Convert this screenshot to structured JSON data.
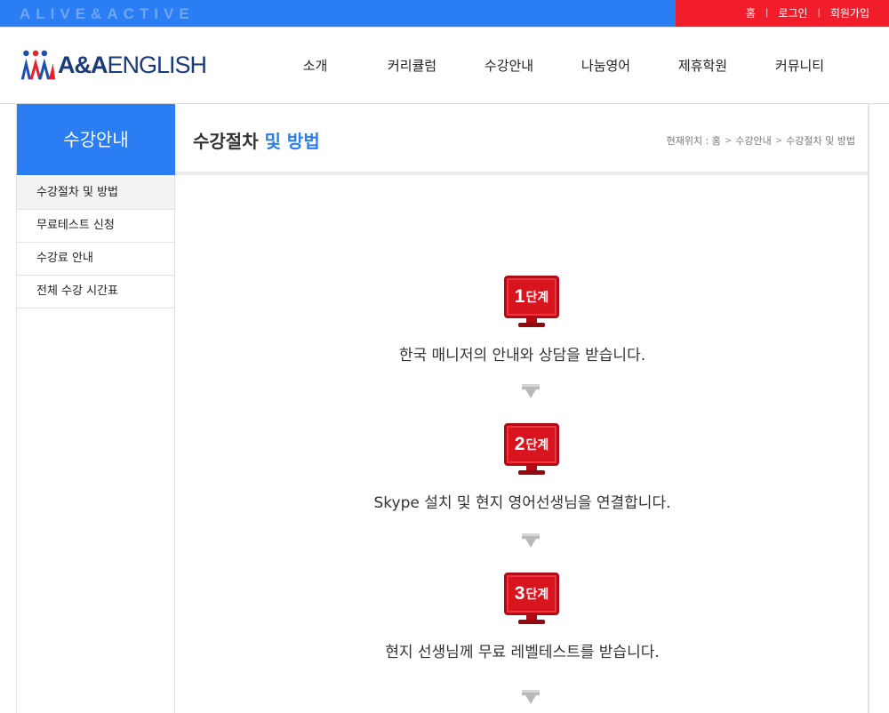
{
  "topbar": {
    "slogan": "ALIVE&ACTIVE",
    "links": [
      "홈",
      "로그인",
      "회원가입"
    ]
  },
  "header": {
    "logo_brand": "A&A",
    "logo_word": "ENGLISH",
    "nav": [
      "소개",
      "커리큘럼",
      "수강안내",
      "나눔영어",
      "제휴학원",
      "커뮤니티"
    ]
  },
  "sidebar": {
    "title": "수강안내",
    "items": [
      {
        "label": "수강절차 및 방법",
        "active": true
      },
      {
        "label": "무료테스트 신청",
        "active": false
      },
      {
        "label": "수강료 안내",
        "active": false
      },
      {
        "label": "전체 수강 시간표",
        "active": false
      }
    ]
  },
  "content": {
    "title_main": "수강절차",
    "title_highlight": " 및 방법",
    "location": {
      "prefix": "현재위치 : 홈",
      "crumb1": "수강안내",
      "crumb2": "수강절차 및 방법"
    },
    "steps": [
      {
        "num": "1",
        "label": "단계",
        "text": "한국 매니저의 안내와 상담을 받습니다."
      },
      {
        "num": "2",
        "label": "단계",
        "text": "Skype 설치 및 현지 영어선생님을 연결합니다."
      },
      {
        "num": "3",
        "label": "단계",
        "text": "현지 선생님께 무료 레벨테스트를 받습니다."
      }
    ]
  },
  "colors": {
    "blue": "#2a7df2",
    "red": "#f21d2a",
    "step_red": "#d8141f"
  }
}
